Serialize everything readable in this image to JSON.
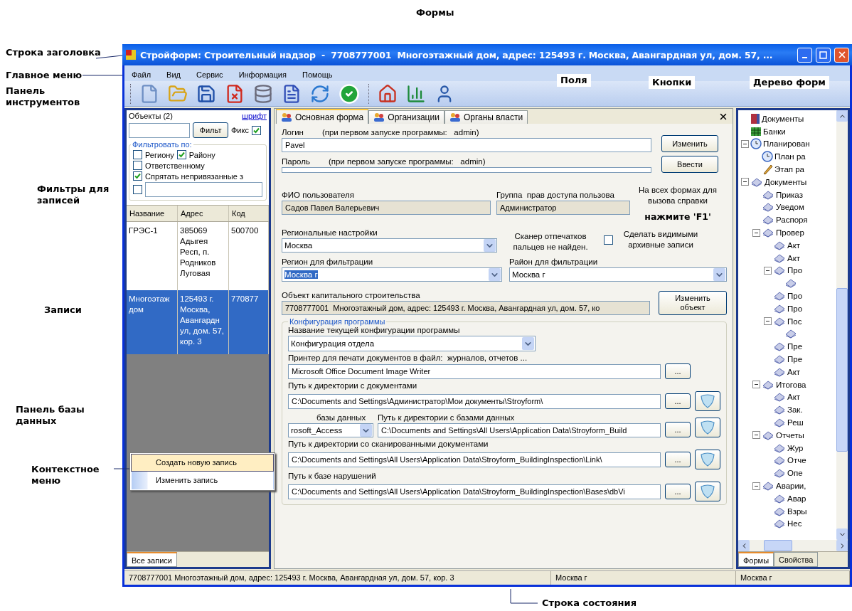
{
  "annotations": [
    "Формы",
    "Строка заголовка",
    "Главное меню",
    "Панель инструментов",
    "Поля",
    "Кнопки",
    "Дерево форм",
    "Фильтры для записей",
    "Записи",
    "Панель базы данных",
    "Контекстное меню",
    "Строка состояния"
  ],
  "window": {
    "title": "Стройформ: Строительный надзор  -  7708777001  Многоэтажный дом, адрес: 125493 г. Москва, Авангардная ул, дом. 57, ..."
  },
  "menu": [
    "Файл",
    "Вид",
    "Сервис",
    "Информация",
    "Помощь"
  ],
  "database_panel": {
    "title": "Объекты (2)",
    "font_link": "шрифт",
    "filter_button": "Фильт",
    "fix": {
      "label": "Фикс",
      "checked": true
    },
    "filter_group": "Фильтровать по:",
    "filters": [
      {
        "label": "Региону",
        "checked": false
      },
      {
        "label": "Району",
        "checked": true
      },
      {
        "label": "Ответственному",
        "checked": false
      },
      {
        "label": "Спрятать  непривязанные з",
        "checked": true
      },
      {
        "checked": false
      }
    ],
    "columns": [
      "Название",
      "Адрес",
      "Код"
    ],
    "rows": [
      {
        "cells": [
          "ГРЭС-1",
          "385069 Адыгея Респ, п. Родников Луговая",
          "500700"
        ],
        "selected": false
      },
      {
        "cells": [
          "Многоэтаж дом",
          "125493 г. Москва, Авангардн ул, дом. 57, кор. 3",
          "770877"
        ],
        "selected": true
      }
    ],
    "context_menu": [
      {
        "label": "Создать новую запись",
        "selected": true
      },
      {
        "label": "Изменить запись",
        "selected": false
      }
    ],
    "tabs": [
      {
        "label": "Все записи",
        "selected": true
      }
    ]
  },
  "form": {
    "tabs": [
      {
        "label": "Основная форма",
        "selected": true
      },
      {
        "label": "Организации",
        "selected": false
      },
      {
        "label": "Органы власти",
        "selected": false
      }
    ],
    "login": {
      "label": "Логин",
      "hint": "(при первом запуске программы:   admin)",
      "value": "Pavel",
      "button": "Изменить"
    },
    "password": {
      "label": "Пароль",
      "hint": "(при первом запуске программы:   admin)",
      "button": "Ввести"
    },
    "user_name": {
      "label": "ФИО пользователя",
      "value": "Садов Павел Валерьевич"
    },
    "user_group": {
      "label": "Группа  прав доступа пользова",
      "value": "Администратор"
    },
    "help": {
      "text": "На всех формах для вызова справки",
      "key": "нажмите 'F1'"
    },
    "regional": {
      "label": "Региональные настройки",
      "value": "Москва"
    },
    "scanner": "Сканер отпечатков пальцев не найден.",
    "archive": {
      "label": "Сделать видимыми архивные записи",
      "checked": false
    },
    "region_filter": {
      "label": "Регион для фильтрации",
      "value": "Москва г"
    },
    "district_filter": {
      "label": "Район для фильтрации",
      "value": "Москва г"
    },
    "object": {
      "label": "Объект капитального строительства",
      "value": "7708777001  Многоэтажный дом, адрес: 125493 г. Москва, Авангардная ул, дом. 57, ко",
      "button": "Изменить объект"
    },
    "config": {
      "title": "Конфигурация программы",
      "name_label": "Название текущей конфигурации программы",
      "name_value": "Конфигурация отдела",
      "printer": {
        "label": "Принтер для печати документов в файл:  журналов, отчетов ...",
        "value": "Microsoft Office Document Image Writer",
        "browse": "..."
      },
      "docs": {
        "label": "Путь к директории с документами",
        "value": "C:\\Documents and Settings\\Администратор\\Мои документы\\Stroyform\\",
        "browse": "..."
      },
      "db_type": {
        "label": "базы данных",
        "value": "rosoft_Access"
      },
      "db_path": {
        "label": "Путь к директории с базами данных",
        "value": "C:\\Documents and Settings\\All Users\\Application Data\\Stroyform_Build",
        "browse": "..."
      },
      "scans": {
        "label": "Путь к директории со сканированными документами",
        "value": "C:\\Documents and Settings\\All Users\\Application Data\\Stroyform_BuildingInspection\\Link\\",
        "browse": "..."
      },
      "violations": {
        "label": "Путь к базе нарушений",
        "value": "C:\\Documents and Settings\\All Users\\Application Data\\Stroyform_BuildingInspection\\Bases\\dbVi",
        "browse": "..."
      }
    }
  },
  "tree": [
    {
      "label": "Документы",
      "kind": "book"
    },
    {
      "label": "Банки",
      "kind": "bank"
    },
    {
      "label": "Планирован",
      "kind": "clock",
      "expanded": true,
      "children": [
        {
          "label": "План ра",
          "kind": "clock"
        },
        {
          "label": "Этап ра",
          "kind": "pen"
        }
      ]
    },
    {
      "label": "Документы",
      "kind": "doc",
      "expanded": true,
      "children": [
        {
          "label": "Приказ",
          "kind": "doc"
        },
        {
          "label": "Уведом",
          "kind": "doc"
        },
        {
          "label": "Распоря",
          "kind": "doc"
        },
        {
          "label": "Провер",
          "kind": "doc",
          "expanded": true,
          "children": [
            {
              "label": "Акт",
              "kind": "doc"
            },
            {
              "label": "Акт",
              "kind": "doc"
            },
            {
              "label": "Про",
              "kind": "doc",
              "expanded": true,
              "children": [
                {
                  "kind": "doc"
                }
              ]
            },
            {
              "label": "Про",
              "kind": "doc"
            },
            {
              "label": "Про",
              "kind": "doc"
            },
            {
              "label": "Пос",
              "kind": "doc",
              "expanded": true,
              "children": [
                {
                  "kind": "doc"
                }
              ]
            },
            {
              "label": "Пре",
              "kind": "doc"
            },
            {
              "label": "Пре",
              "kind": "doc"
            },
            {
              "label": "Акт",
              "kind": "doc"
            }
          ]
        },
        {
          "label": "Итогова",
          "kind": "doc",
          "expanded": true,
          "children": [
            {
              "label": "Акт",
              "kind": "doc"
            },
            {
              "label": "Зак.",
              "kind": "doc"
            },
            {
              "label": "Реш",
              "kind": "doc"
            }
          ]
        },
        {
          "label": "Отчеты",
          "kind": "doc",
          "expanded": true,
          "children": [
            {
              "label": "Жур",
              "kind": "doc"
            },
            {
              "label": "Отче",
              "kind": "doc"
            },
            {
              "label": "Опе",
              "kind": "doc"
            }
          ]
        },
        {
          "label": "Аварии,",
          "kind": "doc",
          "expanded": true,
          "children": [
            {
              "label": "Авар",
              "kind": "doc"
            },
            {
              "label": "Взры",
              "kind": "doc"
            },
            {
              "label": "Нес",
              "kind": "doc"
            }
          ]
        }
      ]
    }
  ],
  "tree_tabs": [
    {
      "label": "Формы",
      "selected": true
    },
    {
      "label": "Свойства",
      "selected": false
    }
  ],
  "status_bar": [
    "7708777001  Многоэтажный дом, адрес: 125493 г. Москва, Авангардная ул, дом. 57, кор. 3",
    "Москва г",
    "Москва г"
  ]
}
